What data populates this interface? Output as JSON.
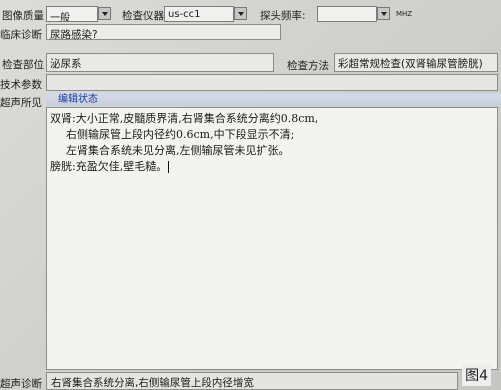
{
  "header": {
    "image_quality_label": "图像质量",
    "image_quality_value": "一般",
    "instrument_label": "检查仪器",
    "instrument_value": "us-cc1",
    "probe_freq_label": "探头频率:",
    "probe_freq_value": "",
    "probe_freq_unit": "MHZ",
    "clinical_diag_label": "临床诊断",
    "clinical_diag_value": "尿路感染?"
  },
  "exam": {
    "site_label": "检查部位",
    "site_value": "泌尿系",
    "method_label": "检查方法",
    "method_value": "彩超常规检查(双肾输尿管膀胱)",
    "tech_params_label": "技术参数",
    "tech_params_value": ""
  },
  "findings": {
    "label": "超声所见",
    "mode_label": "编辑状态",
    "lines": [
      "双肾:大小正常,皮髓质界清,右肾集合系统分离约0.8cm,",
      "右侧输尿管上段内径约0.6cm,中下段显示不清;",
      "左肾集合系统未见分离,左侧输尿管未见扩张。",
      "膀胱:充盈欠佳,壁毛糙。"
    ]
  },
  "diagnosis": {
    "label": "超声诊断",
    "value": "右肾集合系统分离,右侧输尿管上段内径增宽"
  },
  "figure_label": "图4"
}
